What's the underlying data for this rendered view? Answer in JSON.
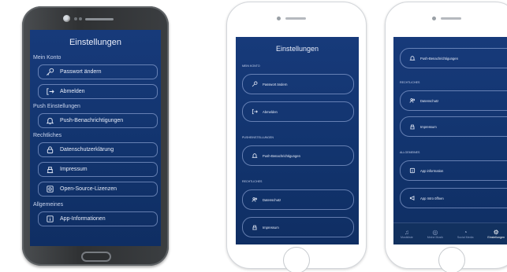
{
  "android": {
    "title": "Einstellungen",
    "sections": {
      "konto": "Mein Konto",
      "push": "Push Einstellungen",
      "rechtliches": "Rechtliches",
      "allgemeines": "Allgemeines"
    },
    "items": {
      "passwort": "Passwort ändern",
      "abmelden": "Abmelden",
      "push": "Push-Benachrichtigungen",
      "datenschutz": "Datenschutzerklärung",
      "impressum": "Impressum",
      "opensource": "Open-Source-Lizenzen",
      "appinfo": "App-Informationen"
    }
  },
  "iphone1": {
    "title": "Einstellungen",
    "sections": {
      "konto": "MEIN KONTO",
      "push": "PUSHEINSTELLUNGEN",
      "rechtliches": "RECHTLICHES"
    },
    "items": {
      "passwort": "Passwort ändern",
      "abmelden": "Abmelden",
      "push": "Push-Benachrichtigungen",
      "datenschutz": "Datenschutz",
      "impressum": "Impressum"
    }
  },
  "iphone2": {
    "sections": {
      "rechtliches": "RECHTLICHES",
      "allgemeines": "ALLGEMEINES"
    },
    "items": {
      "push": "Push-Benachrichtigungen",
      "datenschutz": "Datenschutz",
      "impressum": "Impressum",
      "appinfo": "App information",
      "appintro": "App Intro öffnen"
    },
    "tabs": [
      "Musikliste",
      "Meine Musik",
      "Social Media",
      "Einstellungen"
    ]
  },
  "colors": {
    "screen_bg": "#173a7a",
    "text": "#e8edf9",
    "border": "#aabeeb"
  }
}
